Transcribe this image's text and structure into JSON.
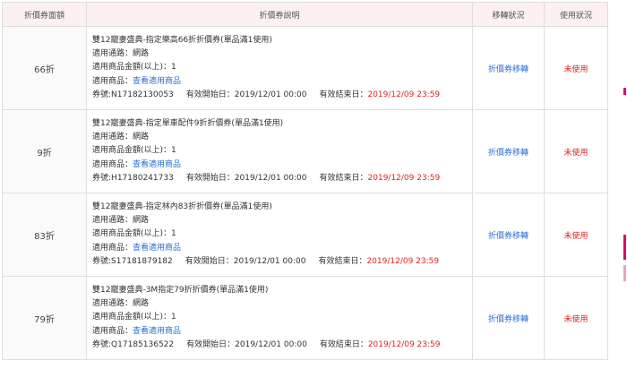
{
  "headers": {
    "value": "折價券面額",
    "description": "折價券說明",
    "transfer": "移轉狀況",
    "usage": "使用狀況"
  },
  "field_labels": {
    "channel": "適用通路：",
    "min_amount": "適用商品金額(以上)：",
    "products": "適用商品：",
    "code": "券號:",
    "start": "有效開始日：",
    "end": "有效結束日："
  },
  "coupons": [
    {
      "value": "66折",
      "title": "雙12寵妻盛典-指定樂高66折折價券(單品滿1使用)",
      "channel": "網路",
      "min_amount": "1",
      "products_link": "查看適用商品",
      "code": "N17182130053",
      "start": "2019/12/01 00:00",
      "end": "2019/12/09 23:59",
      "transfer": "折價券移轉",
      "usage": "未使用"
    },
    {
      "value": "9折",
      "title": "雙12寵妻盛典-指定單車配件9折折價券(單品滿1使用)",
      "channel": "網路",
      "min_amount": "1",
      "products_link": "查看適用商品",
      "code": "H17180241733",
      "start": "2019/12/01 00:00",
      "end": "2019/12/09 23:59",
      "transfer": "折價券移轉",
      "usage": "未使用"
    },
    {
      "value": "83折",
      "title": "雙12寵妻盛典-指定林內83折折價券(單品滿1使用)",
      "channel": "網路",
      "min_amount": "1",
      "products_link": "查看適用商品",
      "code": "S17181879182",
      "start": "2019/12/01 00:00",
      "end": "2019/12/09 23:59",
      "transfer": "折價券移轉",
      "usage": "未使用"
    },
    {
      "value": "79折",
      "title": "雙12寵妻盛典-3M指定79折折價券(單品滿1使用)",
      "channel": "網路",
      "min_amount": "1",
      "products_link": "查看適用商品",
      "code": "Q17185136522",
      "start": "2019/12/01 00:00",
      "end": "2019/12/09 23:59",
      "transfer": "折價券移轉",
      "usage": "未使用"
    }
  ],
  "colors": {
    "header_bg": "#fdf0f0",
    "link": "#2a6fd6",
    "status_red": "#e02020"
  }
}
